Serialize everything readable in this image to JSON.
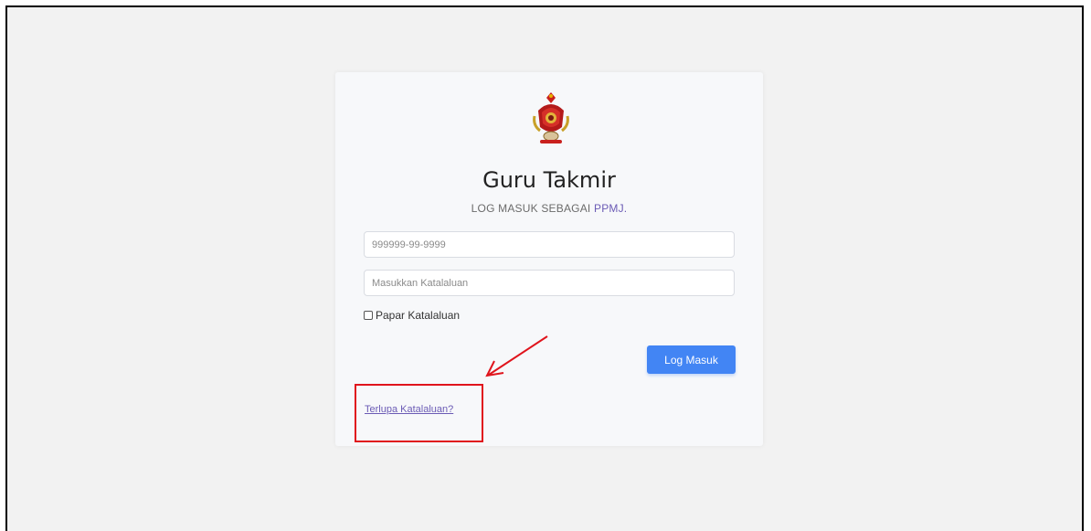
{
  "login": {
    "title": "Guru Takmir",
    "subtitle_prefix": "LOG MASUK SEBAGAI ",
    "subtitle_accent": "PPMJ.",
    "ic_placeholder": "999999-99-9999",
    "password_placeholder": "Masukkan Katalaluan",
    "show_password_label": "Papar Katalaluan",
    "login_button_label": "Log Masuk",
    "forgot_password_link": "Terlupa Katalaluan?"
  },
  "annotation": {
    "color": "#e0141c"
  },
  "colors": {
    "accent": "#6b5bb5",
    "primary_button": "#4285f4"
  }
}
